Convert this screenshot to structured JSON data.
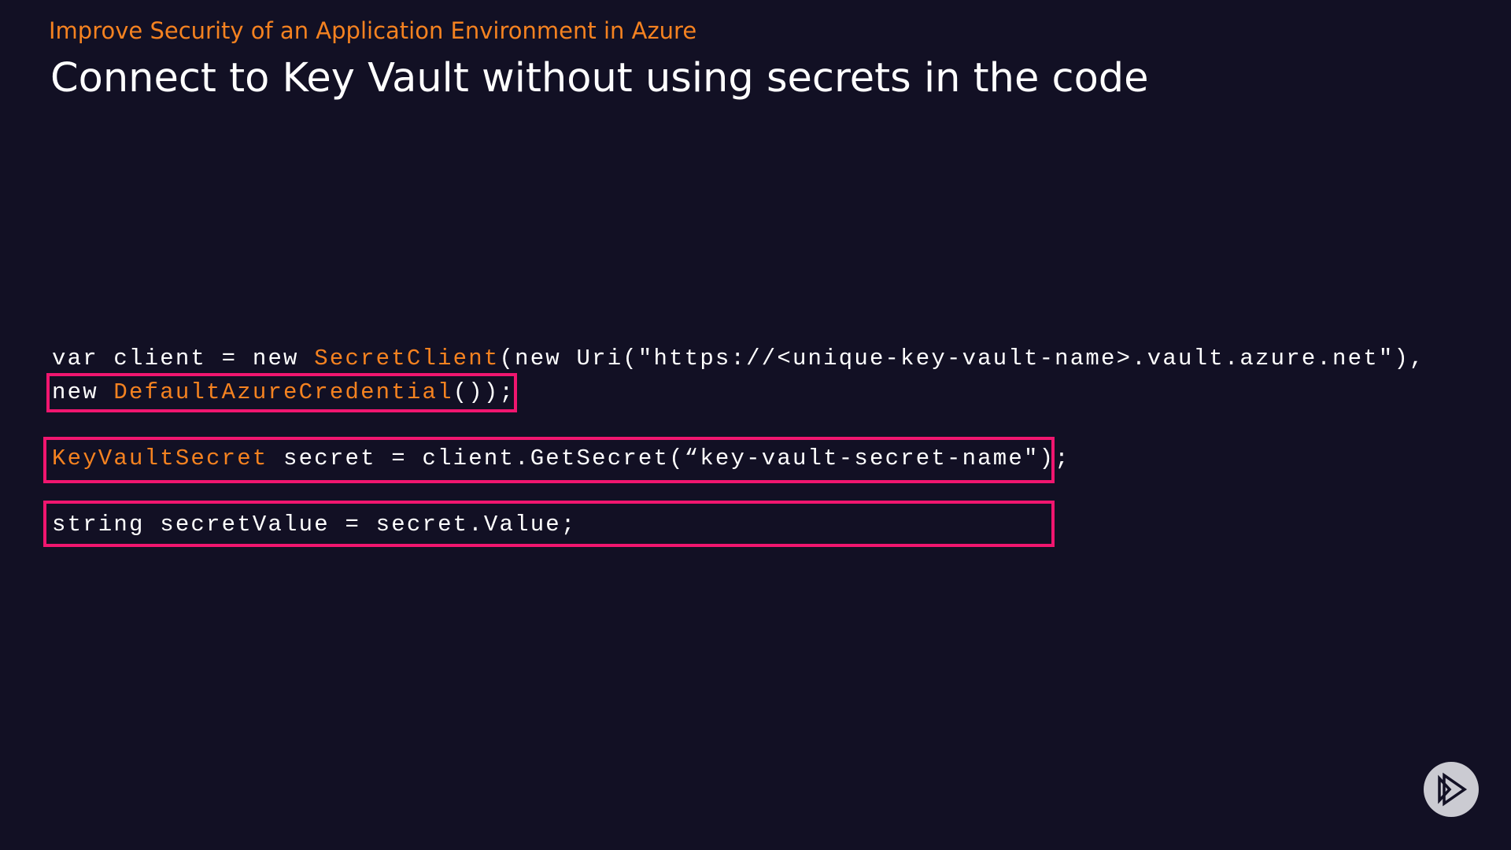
{
  "header": {
    "course_title": "Improve Security of an Application Environment in Azure",
    "slide_title": "Connect to Key Vault without using secrets in the code"
  },
  "code": {
    "line1": {
      "a": "var client = new ",
      "b": "SecretClient",
      "c": "(new Uri(\"https://<unique-key-vault-name>.vault.azure.net\"),"
    },
    "line2": {
      "a": "new ",
      "b": "DefaultAzureCredential",
      "c": "());"
    },
    "line3": {
      "b": "KeyVaultSecret",
      "c": " secret = client.GetSecret(“key-vault-secret-name\");"
    },
    "line4": {
      "c": "string secretValue = secret.Value;"
    }
  },
  "colors": {
    "accent": "#f58220",
    "highlight": "#f0166f",
    "background": "#121024"
  },
  "logo": {
    "icon": "pluralsight-play-icon"
  }
}
